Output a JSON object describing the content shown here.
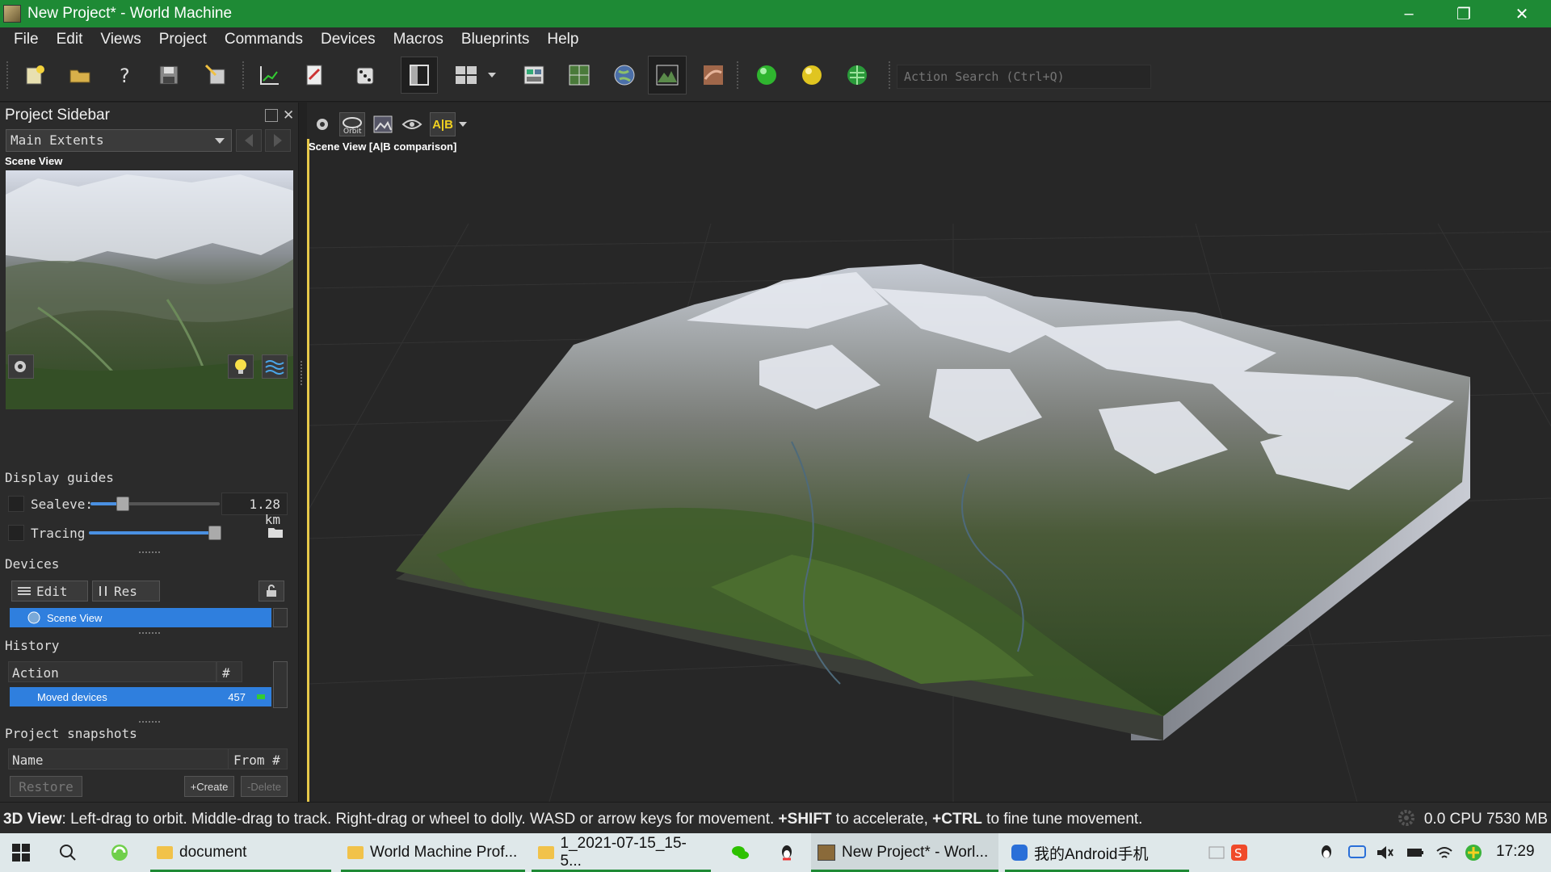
{
  "window": {
    "title": "New Project* - World Machine",
    "controls": [
      "minimize-icon",
      "restore-icon",
      "close-icon"
    ]
  },
  "menu": [
    "File",
    "Edit",
    "Views",
    "Project",
    "Commands",
    "Devices",
    "Macros",
    "Blueprints",
    "Help"
  ],
  "toolbar": {
    "action_search_placeholder": "Action Search (Ctrl+Q)",
    "icons": [
      "new-project-icon",
      "open-folder-icon",
      "help-icon",
      "save-icon",
      "export-icon",
      "graph-icon",
      "report-icon",
      "dice-icon",
      "layout-single-icon",
      "layout-grid-icon",
      "scene-view-icon",
      "map-view-icon",
      "globe-icon",
      "terrain-view-icon",
      "texture-view-icon",
      "green-ball-icon",
      "yellow-ball-icon",
      "world-icon"
    ]
  },
  "sidebar": {
    "title": "Project Sidebar",
    "extents_selected": "Main Extents",
    "preview_label": "Scene View",
    "display_guides_title": "Display guides",
    "sealevel_label": "Sealeve:",
    "sealevel_value": "1.28 km",
    "sealevel_slider": 0.25,
    "tracing_label": "Tracing",
    "tracing_slider": 0.95,
    "devices_title": "Devices",
    "edit_button": "Edit",
    "res_button": "Res",
    "device_selected": "Scene View",
    "history_title": "History",
    "history_col_action": "Action",
    "history_col_num": "#",
    "history_row_action": "Moved devices",
    "history_row_num": "457",
    "snapshots_title": "Project snapshots",
    "snap_col_name": "Name",
    "snap_col_from": "From #",
    "restore_button": "Restore",
    "create_button": "+Create",
    "delete_button": "-Delete"
  },
  "viewport": {
    "label": "Scene View [A|B comparison]",
    "tools": [
      "camera-settings-icon",
      "orbit-icon",
      "render-icon",
      "eye-icon",
      "ab-compare-icon"
    ],
    "ab_label": "A|B",
    "orbit_label": "Orbit"
  },
  "status": {
    "hint_bold": "3D View",
    "hint_1": ": Left-drag to orbit. Middle-drag to track. Right-drag or wheel to dolly. WASD or arrow keys for movement. ",
    "hint_shift": "+SHIFT",
    "hint_2": " to accelerate, ",
    "hint_ctrl": "+CTRL",
    "hint_3": " to fine tune movement.",
    "cpu": "0.0 CPU 7530 MB"
  },
  "taskbar": {
    "tasks": [
      {
        "label": "document"
      },
      {
        "label": "World Machine Prof..."
      },
      {
        "label": "1_2021-07-15_15-5..."
      },
      {
        "label": "New Project* - Worl..."
      },
      {
        "label": "我的Android手机"
      }
    ],
    "clock": "17:29"
  },
  "colors": {
    "accent_green": "#1e8a35",
    "selection_blue": "#2f7fde",
    "viewport_edge": "#e6c84a"
  }
}
